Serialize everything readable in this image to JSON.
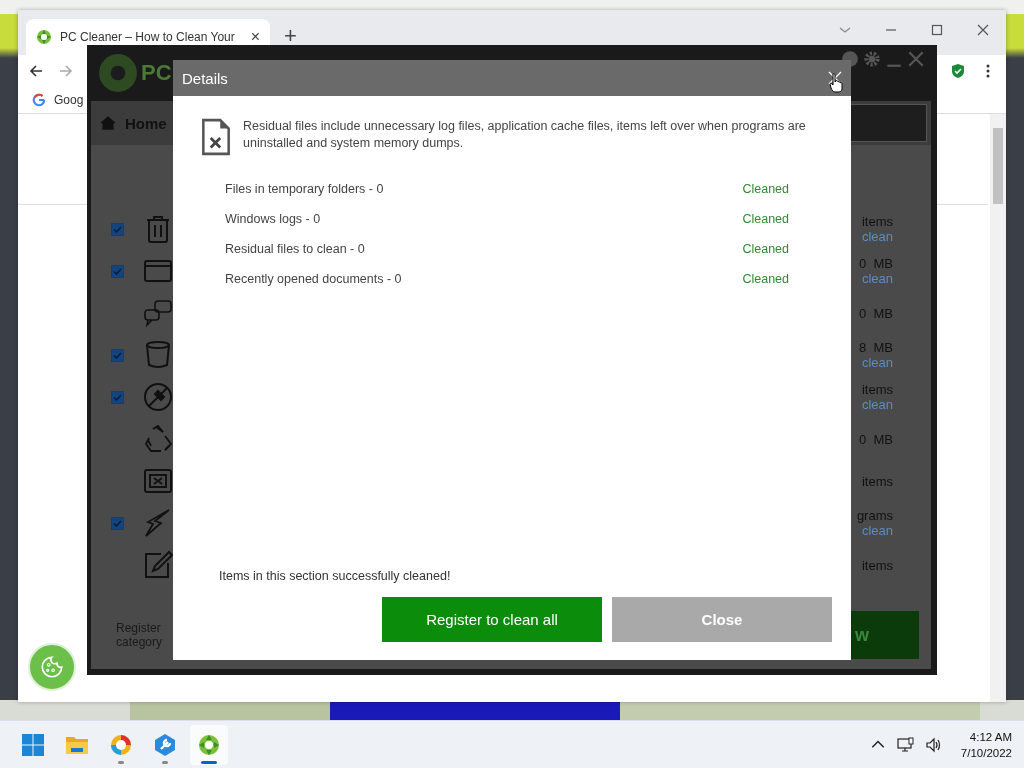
{
  "browser": {
    "tab": {
      "title": "PC Cleaner – How to Clean Your",
      "close": "×"
    },
    "new_tab": "+",
    "bookmark": "Goog"
  },
  "app": {
    "logo": "PC",
    "nav": {
      "label": "Home"
    },
    "rows": [
      {
        "kind": "checkbox",
        "checked": true,
        "values": [
          "items",
          "clean"
        ]
      },
      {
        "kind": "checkbox",
        "checked": true,
        "values": [
          "0  MB",
          "clean"
        ]
      },
      {
        "kind": "plain",
        "values": [
          "0  MB"
        ]
      },
      {
        "kind": "checkbox",
        "checked": true,
        "values": [
          "8  MB",
          "clean"
        ]
      },
      {
        "kind": "checkbox",
        "checked": true,
        "values": [
          "items",
          "clean"
        ]
      },
      {
        "kind": "plain",
        "values": [
          "0  MB"
        ]
      },
      {
        "kind": "plain",
        "values": [
          "items"
        ]
      },
      {
        "kind": "checkbox",
        "checked": true,
        "values": [
          "grams",
          "clean"
        ]
      },
      {
        "kind": "plain",
        "values": [
          "items"
        ]
      }
    ],
    "footer": [
      "Register",
      "category"
    ],
    "action": "w"
  },
  "dialog": {
    "title": "Details",
    "description": "Residual files include unnecessary log files, application cache files, items left over when programs are uninstalled and system memory dumps.",
    "items": [
      {
        "label": "Files in temporary folders - 0",
        "status": "Cleaned"
      },
      {
        "label": "Windows logs - 0",
        "status": "Cleaned"
      },
      {
        "label": "Residual files to clean - 0",
        "status": "Cleaned"
      },
      {
        "label": "Recently opened documents - 0",
        "status": "Cleaned"
      }
    ],
    "message": "Items in this section successfully cleaned!",
    "buttons": [
      {
        "label": "Register to clean all",
        "kind": "primary"
      },
      {
        "label": "Close",
        "kind": "secondary"
      }
    ]
  },
  "taskbar": {
    "apps": [
      {
        "selected": false,
        "running": false
      },
      {
        "selected": false,
        "running": true
      },
      {
        "selected": false,
        "running": true
      },
      {
        "selected": true,
        "running": true
      }
    ],
    "time": "4:12 AM",
    "date": "7/10/2022"
  }
}
